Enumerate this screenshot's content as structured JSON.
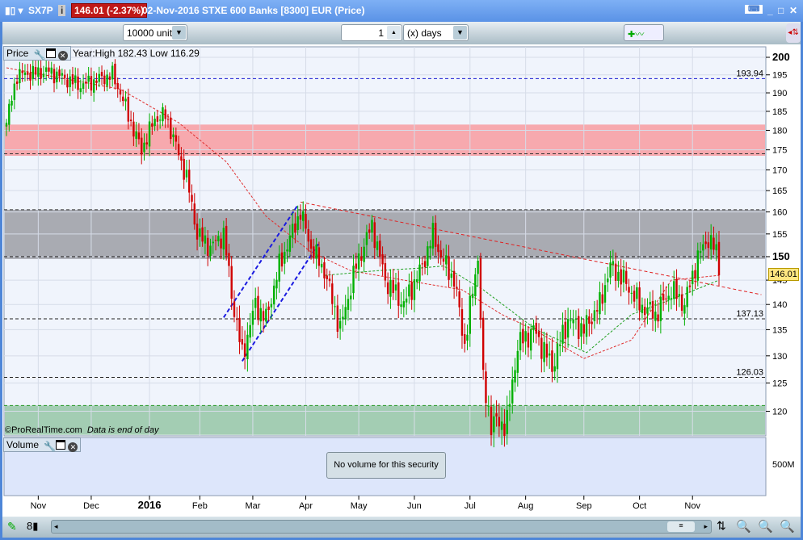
{
  "title": {
    "symbol": "SX7P",
    "price_change": "146.01 (-2.37%)",
    "description": "02-Nov-2016 STXE 600 Banks [8300] EUR (Price)"
  },
  "toolbar": {
    "units": "10000 units",
    "period_value": "1",
    "period_unit": "(x) days"
  },
  "price_pane": {
    "label": "Price",
    "info": "Year:High 182.43 Low 116.29",
    "copyright": "©ProRealTime.com",
    "data_note": "Data is end of day",
    "current_price": "146.01"
  },
  "volume_pane": {
    "label": "Volume",
    "message": "No volume for this security",
    "axis_label": "500M"
  },
  "chart_data": {
    "type": "candlestick",
    "scale": "log",
    "y_ticks": [
      200,
      195,
      190,
      185,
      180,
      175,
      170,
      165,
      160,
      155,
      150,
      145,
      140,
      135,
      130,
      125,
      120
    ],
    "x_ticks": [
      "Nov",
      "Dec",
      "2016",
      "Feb",
      "Mar",
      "Apr",
      "May",
      "Jun",
      "Jul",
      "Aug",
      "Sep",
      "Oct",
      "Nov"
    ],
    "x_tick_days": [
      12,
      32,
      54,
      73,
      93,
      113,
      133,
      154,
      175,
      196,
      218,
      239,
      259
    ],
    "n_days": 270,
    "close_keypoints": [
      [
        0,
        182
      ],
      [
        4,
        195
      ],
      [
        16,
        196
      ],
      [
        28,
        192
      ],
      [
        40,
        195
      ],
      [
        43,
        190
      ],
      [
        48,
        180
      ],
      [
        51,
        175
      ],
      [
        56,
        183
      ],
      [
        60,
        184
      ],
      [
        63,
        178
      ],
      [
        68,
        168
      ],
      [
        72,
        155
      ],
      [
        77,
        152
      ],
      [
        82,
        155
      ],
      [
        85,
        142
      ],
      [
        89,
        130
      ],
      [
        94,
        140
      ],
      [
        98,
        137
      ],
      [
        103,
        148
      ],
      [
        111,
        160
      ],
      [
        115,
        152
      ],
      [
        120,
        147
      ],
      [
        126,
        135
      ],
      [
        132,
        148
      ],
      [
        138,
        157
      ],
      [
        143,
        145
      ],
      [
        150,
        140
      ],
      [
        157,
        148
      ],
      [
        161,
        155
      ],
      [
        164,
        150
      ],
      [
        169,
        145
      ],
      [
        173,
        132
      ],
      [
        178,
        150
      ],
      [
        180,
        125
      ],
      [
        183,
        118
      ],
      [
        189,
        118
      ],
      [
        193,
        132
      ],
      [
        199,
        135
      ],
      [
        206,
        128
      ],
      [
        212,
        137
      ],
      [
        218,
        135
      ],
      [
        224,
        140
      ],
      [
        228,
        148
      ],
      [
        233,
        145
      ],
      [
        239,
        140
      ],
      [
        245,
        138
      ],
      [
        251,
        143
      ],
      [
        256,
        140
      ],
      [
        261,
        150
      ],
      [
        265,
        154
      ],
      [
        268,
        151
      ],
      [
        269,
        146.01
      ]
    ],
    "levels": [
      {
        "value": 193.94,
        "label": "193.94"
      },
      {
        "value": 150,
        "label": "150"
      },
      {
        "value": 137.13,
        "label": "137.13"
      },
      {
        "value": 126.03,
        "label": "126.03"
      }
    ],
    "zones": [
      {
        "from": 173.5,
        "to": 181.5,
        "color": "#f7a9ae"
      },
      {
        "from": 149.5,
        "to": 160.5,
        "color": "#a9abb2"
      },
      {
        "from": 116,
        "to": 121,
        "color": "#a3cdb3"
      }
    ],
    "ma_red": [
      [
        0,
        197
      ],
      [
        43,
        191
      ],
      [
        65,
        182
      ],
      [
        83,
        172
      ],
      [
        98,
        159
      ],
      [
        115,
        151
      ],
      [
        130,
        147
      ],
      [
        150,
        145
      ],
      [
        172,
        143
      ],
      [
        187,
        138
      ],
      [
        199,
        135
      ],
      [
        218,
        129.5
      ],
      [
        236,
        133
      ],
      [
        251,
        145
      ],
      [
        269,
        146
      ]
    ],
    "ma_green": [
      [
        120,
        146
      ],
      [
        140,
        147
      ],
      [
        155,
        147.5
      ],
      [
        165,
        148
      ],
      [
        180,
        143
      ],
      [
        200,
        135
      ],
      [
        219,
        130.6
      ],
      [
        236,
        138
      ],
      [
        251,
        141
      ],
      [
        269,
        145
      ]
    ],
    "trendlines": [
      {
        "points": [
          [
            111,
            162.3
          ],
          [
            285,
            142
          ]
        ],
        "color": "#e02020"
      },
      {
        "points": [
          [
            82,
            137.4
          ],
          [
            110,
            161.6
          ]
        ],
        "color": "#1a1ae0"
      },
      {
        "points": [
          [
            89,
            129
          ],
          [
            118,
            153
          ]
        ],
        "color": "#1a1ae0"
      }
    ],
    "up_color": "#00b000",
    "down_color": "#d00000"
  }
}
